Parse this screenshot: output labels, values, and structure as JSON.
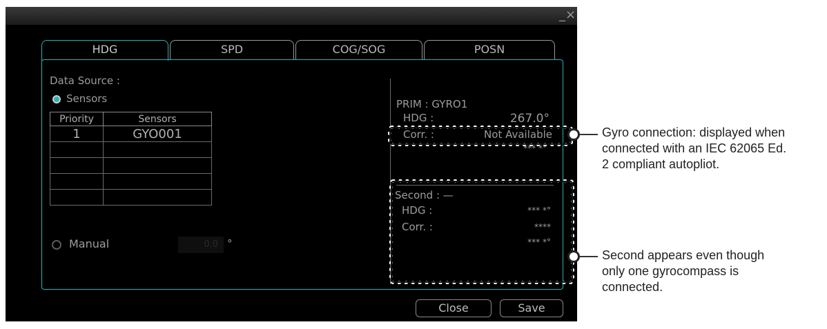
{
  "window": {
    "minimize_glyph": "_",
    "close_glyph": "×"
  },
  "tabs": [
    {
      "label": "HDG",
      "active": true
    },
    {
      "label": "SPD",
      "active": false
    },
    {
      "label": "COG/SOG",
      "active": false
    },
    {
      "label": "POSN",
      "active": false
    }
  ],
  "data_source": {
    "label": "Data Source :",
    "sensors_option": "Sensors",
    "manual_option": "Manual",
    "manual_value": "0.0",
    "manual_unit": "°"
  },
  "sensor_table": {
    "headers": [
      "Priority",
      "Sensors"
    ],
    "rows": [
      [
        "1",
        "GYO001"
      ],
      [
        "",
        ""
      ],
      [
        "",
        ""
      ],
      [
        "",
        ""
      ],
      [
        "",
        ""
      ]
    ]
  },
  "primary": {
    "title": "PRIM : GYRO1",
    "hdg_label": "HDG :",
    "hdg_value": "267.0°",
    "corr_label": "Corr. :",
    "corr_value": "Not Available",
    "extra_value": "*** *°"
  },
  "second": {
    "title": "Second : —",
    "hdg_label": "HDG :",
    "hdg_value": "*** *°",
    "corr_label": "Corr. :",
    "corr_value": "****",
    "extra_value": "*** *°"
  },
  "buttons": {
    "close": "Close",
    "save": "Save"
  },
  "annotations": {
    "gyro_note": [
      "Gyro connection: displayed when",
      "connected with an IEC 62065 Ed.",
      "2 compliant autopliot."
    ],
    "second_note": [
      "Second appears even though",
      "only one gyrocompass is",
      "connected."
    ]
  },
  "colors": {
    "accent": "#2bb3b6",
    "background": "#000000",
    "text": "#9c9c9c"
  }
}
